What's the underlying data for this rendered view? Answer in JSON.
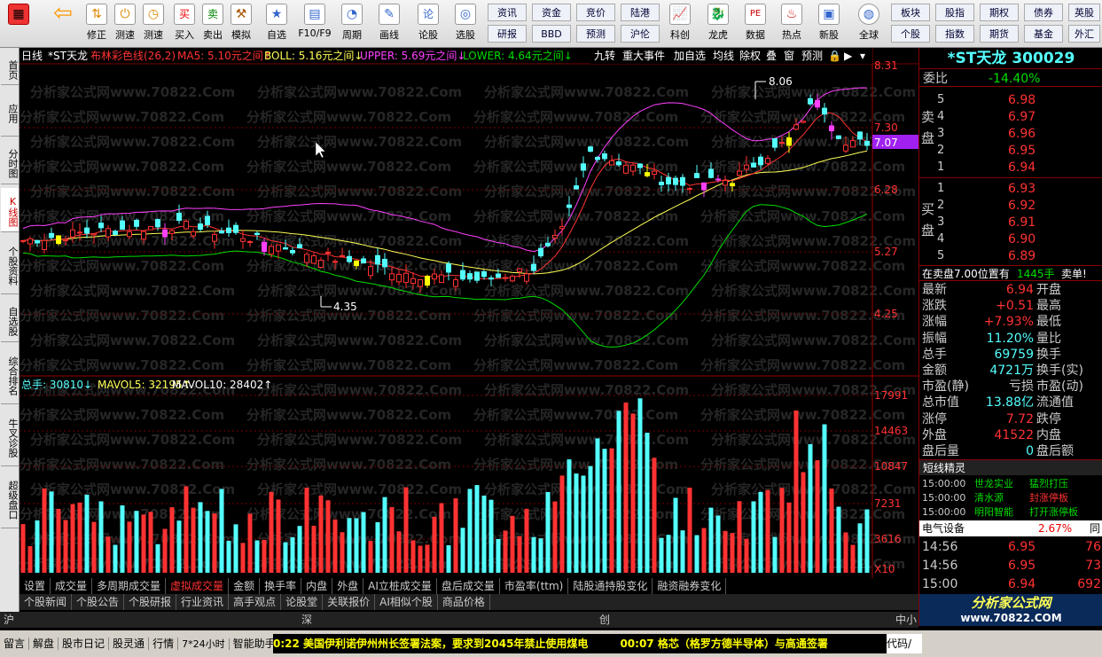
{
  "toolbar": {
    "buttons": [
      {
        "name": "back",
        "label": ""
      },
      {
        "name": "modify",
        "label": "修正"
      },
      {
        "name": "measure",
        "label": "测速"
      },
      {
        "name": "buy",
        "label": "买入"
      },
      {
        "name": "sell",
        "label": "卖出"
      },
      {
        "name": "simulate",
        "label": "模拟"
      },
      {
        "name": "watchlist",
        "label": "自选"
      },
      {
        "name": "f10",
        "label": "F10/F9"
      },
      {
        "name": "period",
        "label": "周期"
      },
      {
        "name": "draw",
        "label": "画线"
      },
      {
        "name": "forum",
        "label": "论股"
      },
      {
        "name": "pick",
        "label": "选股"
      }
    ],
    "grid": [
      [
        "资讯",
        "资金",
        "竞价",
        "陆港"
      ],
      [
        "研报",
        "BBD",
        "预测",
        "沪伦"
      ]
    ],
    "buttons2": [
      {
        "name": "kechuang",
        "label": "科创"
      },
      {
        "name": "longhu",
        "label": "龙虎"
      },
      {
        "name": "data",
        "label": "数据"
      },
      {
        "name": "hot",
        "label": "热点"
      },
      {
        "name": "newstock",
        "label": "新股"
      },
      {
        "name": "global",
        "label": "全球"
      }
    ],
    "grid2": [
      [
        "板块",
        "股指",
        "期权",
        "债券",
        "英股"
      ],
      [
        "个股",
        "指数",
        "期货",
        "基金",
        "外汇"
      ]
    ]
  },
  "left_tabs": [
    "首页",
    "应用",
    "分时图",
    "K线图",
    "个股资料",
    "自选股",
    "综合排名",
    "牛叉诊股",
    "超级盘口"
  ],
  "indicator_bar": {
    "period": "日线",
    "name": "*ST天龙",
    "ind": "布林彩色线(26,2)",
    "ma5": "MA5: 5.10元之间↑",
    "boll": "BOLL: 5.16元之间↓",
    "upper": "UPPER: 5.69元之间↓",
    "lower": "LOWER: 4.64元之间↓"
  },
  "chart_tools": [
    "九转",
    "重大事件",
    "加自选",
    "均线",
    "除权",
    "叠",
    "窗",
    "预测"
  ],
  "price_axis": [
    "8.31",
    "7.30",
    "7.07",
    "6.28",
    "5.27",
    "4.25"
  ],
  "price_annotations": {
    "high": "8.06",
    "low": "4.35"
  },
  "volume_bar": {
    "total": "总手: 30810↓",
    "mavol5": "MAVOL5: 32195↑",
    "mavol10": "MAVOL10: 28402↑"
  },
  "volume_axis": [
    "17991",
    "14463",
    "10847",
    "7231",
    "3616",
    "X10"
  ],
  "watermark": "分析家公式网www.70822.Com",
  "tabs_row1": [
    "设置",
    "成交量",
    "多周期成交量",
    "虚拟成交量",
    "金额",
    "换手率",
    "内盘",
    "外盘",
    "AI立桩成交量",
    "盘后成交量",
    "市盈率(ttm)",
    "陆股通持股变化",
    "融资融券变化"
  ],
  "tabs_row2": [
    "个股新闻",
    "个股公告",
    "个股研报",
    "行业资讯",
    "高手观点",
    "论股堂",
    "关联报价",
    "AI相似个股",
    "商品价格"
  ],
  "right_panel": {
    "title": "*ST天龙",
    "code": "300029",
    "weibi_label": "委比",
    "weibi": "-14.40%",
    "sell_label": "卖盘",
    "buy_label": "买盘",
    "asks": [
      {
        "n": "5",
        "p": "6.98"
      },
      {
        "n": "4",
        "p": "6.97"
      },
      {
        "n": "3",
        "p": "6.96"
      },
      {
        "n": "2",
        "p": "6.95"
      },
      {
        "n": "1",
        "p": "6.94"
      }
    ],
    "bids": [
      {
        "n": "1",
        "p": "6.93"
      },
      {
        "n": "2",
        "p": "6.92"
      },
      {
        "n": "3",
        "p": "6.91"
      },
      {
        "n": "4",
        "p": "6.90"
      },
      {
        "n": "5",
        "p": "6.89"
      }
    ],
    "notice": "在卖盘7.00位置有",
    "notice_qty": "1445手",
    "notice_tag": "卖单!",
    "stats": [
      [
        "最新",
        "6.94",
        "开盘",
        ""
      ],
      [
        "涨跌",
        "+0.51",
        "最高",
        ""
      ],
      [
        "涨幅",
        "+7.93%",
        "最低",
        ""
      ],
      [
        "振幅",
        "11.20%",
        "量比",
        ""
      ],
      [
        "总手",
        "69759",
        "换手",
        ""
      ],
      [
        "金额",
        "4721万",
        "换手(实)",
        ""
      ],
      [
        "市盈(静)",
        "亏损",
        "市盈(动)",
        ""
      ],
      [
        "总市值",
        "13.88亿",
        "流通值",
        ""
      ],
      [
        "涨停",
        "7.72",
        "跌停",
        ""
      ],
      [
        "外盘",
        "41522",
        "内盘",
        ""
      ],
      [
        "盘后量",
        "0",
        "盘后额",
        ""
      ]
    ],
    "sprite_title": "短线精灵",
    "sprites": [
      [
        "15:00:00",
        "世龙实业",
        "猛烈打压"
      ],
      [
        "15:00:00",
        "清水源",
        "封涨停板"
      ],
      [
        "15:00:00",
        "明阳智能",
        "打开涨停板"
      ]
    ],
    "sector": "电气设备",
    "sector_pct": "2.67%",
    "sector_tag": "同",
    "ticks": [
      [
        "14:56",
        "6.95",
        "76"
      ],
      [
        "14:56",
        "6.95",
        "73"
      ],
      [
        "15:00",
        "6.94",
        "692"
      ]
    ],
    "logo": "分析家公式网",
    "logo_url": "www.70822.COM"
  },
  "market_bar": [
    "沪",
    "深",
    "创",
    "中小"
  ],
  "footer": {
    "items": [
      "留言",
      "解盘",
      "股市日记",
      "股灵通",
      "行情",
      "7*24小时",
      "智能助手"
    ],
    "news1": "0:22 美国伊利诺伊州州长签署法案，要求到2045年禁止使用煤电",
    "news2": "00:07 格芯（格罗方德半导体）与高通签署",
    "last": "代码/"
  },
  "colors": {
    "up": "#ff3232",
    "down": "#54ffff",
    "upper": "#ff40ff",
    "lower": "#00dd00",
    "mid": "#ffff55"
  },
  "chart_data": {
    "type": "candlestick",
    "symbol": "*ST天龙",
    "period": "daily",
    "ylim": [
      4.25,
      8.31
    ],
    "volume_ylim": [
      0,
      17991
    ],
    "annotations": [
      {
        "label": "8.06"
      },
      {
        "label": "4.35"
      }
    ]
  }
}
